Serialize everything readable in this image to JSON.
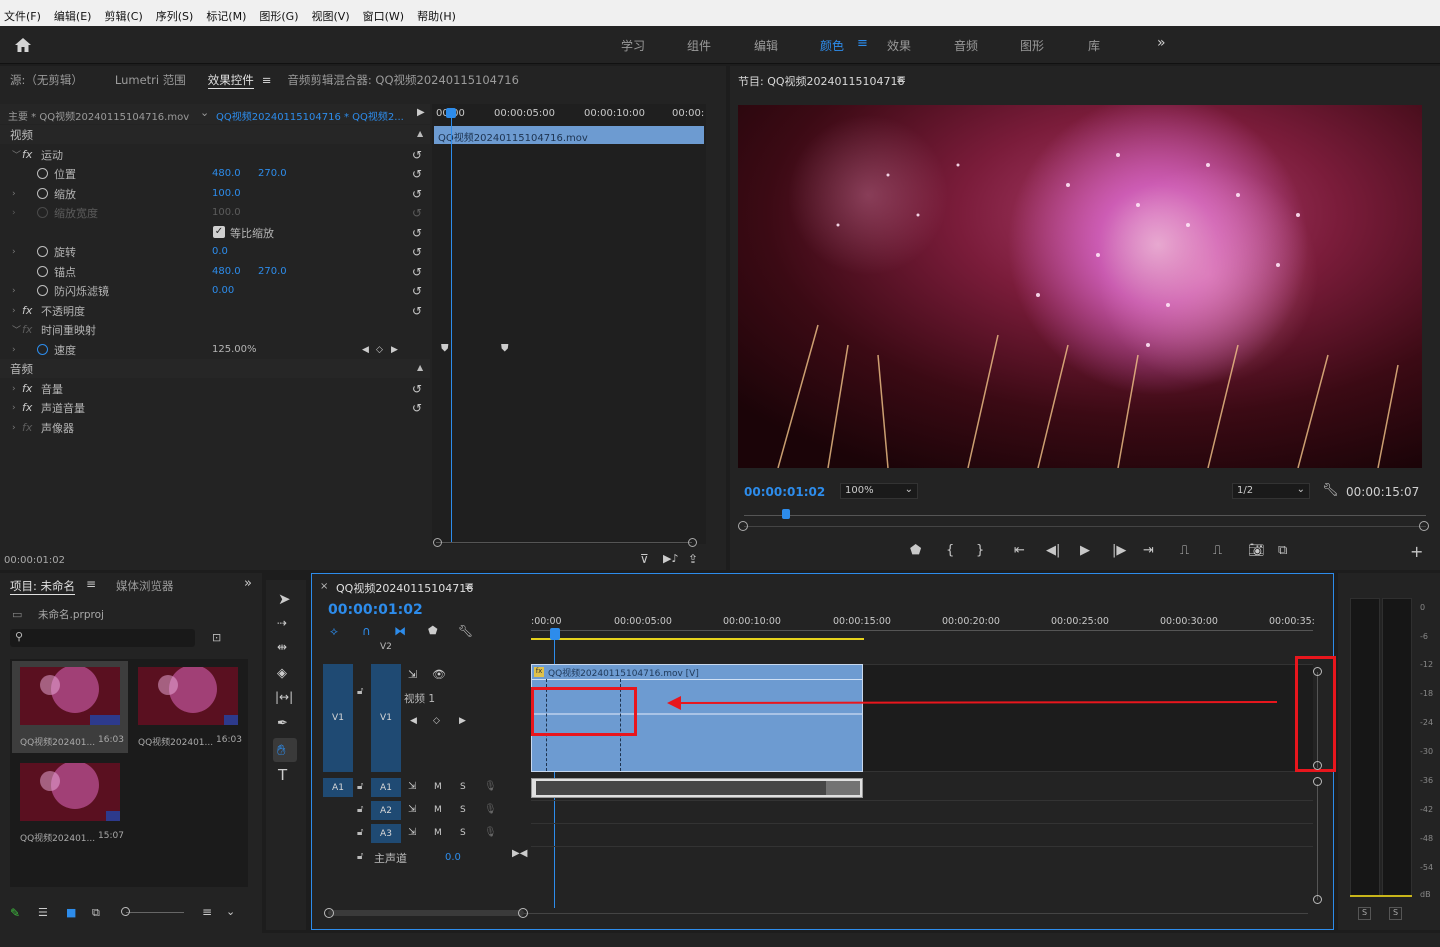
{
  "menu": [
    "文件(F)",
    "编辑(E)",
    "剪辑(C)",
    "序列(S)",
    "标记(M)",
    "图形(G)",
    "视图(V)",
    "窗口(W)",
    "帮助(H)"
  ],
  "workspaces": [
    "学习",
    "组件",
    "编辑",
    "颜色",
    "效果",
    "音频",
    "图形",
    "库"
  ],
  "active_workspace": "颜色",
  "source_tabs": {
    "source": "源:（无剪辑）",
    "lumetri": "Lumetri 范围",
    "effect_controls": "效果控件",
    "audio_mixer": "音频剪辑混合器: QQ视频20240115104716"
  },
  "ec": {
    "master": "主要 * QQ视频20240115104716.mov",
    "clip": "QQ视频20240115104716 * QQ视频2...",
    "ruler": [
      "00:00",
      "00:00:05:00",
      "00:00:10:00",
      "00:00:"
    ],
    "clipbar": "QQ视频20240115104716.mov",
    "video": "视频",
    "motion": "运动",
    "position": "位置",
    "pos_x": "480.0",
    "pos_y": "270.0",
    "scale": "缩放",
    "scale_v": "100.0",
    "scale_w": "缩放宽度",
    "scale_w_v": "100.0",
    "uniform": "等比缩放",
    "rotation": "旋转",
    "rot_v": "0.0",
    "anchor": "锚点",
    "anc_x": "480.0",
    "anc_y": "270.0",
    "flicker": "防闪烁滤镜",
    "flicker_v": "0.00",
    "opacity": "不透明度",
    "remap": "时间重映射",
    "speed": "速度",
    "speed_v": "125.00%",
    "audio": "音频",
    "volume": "音量",
    "channel": "声道音量",
    "panner": "声像器",
    "timecode": "00:00:01:02"
  },
  "program": {
    "title": "节目: QQ视频20240115104716",
    "timecode": "00:00:01:02",
    "zoom": "100%",
    "quality": "1/2",
    "duration": "00:00:15:07"
  },
  "project": {
    "tab": "项目: 未命名",
    "media": "媒体浏览器",
    "file": "未命名.prproj",
    "items": [
      {
        "name": "QQ视频202401...",
        "dur": "16:03"
      },
      {
        "name": "QQ视频202401...",
        "dur": "16:03"
      },
      {
        "name": "QQ视频202401...",
        "dur": "15:07"
      }
    ]
  },
  "timeline": {
    "title": "QQ视频20240115104716",
    "timecode": "00:00:01:02",
    "ruler": [
      ":00:00",
      "00:00:05:00",
      "00:00:10:00",
      "00:00:15:00",
      "00:00:20:00",
      "00:00:25:00",
      "00:00:30:00",
      "00:00:35:"
    ],
    "v2": "V2",
    "v1": "V1",
    "video1": "视频 1",
    "a1": "A1",
    "a2": "A2",
    "a3": "A3",
    "master": "主声道",
    "master_v": "0.0",
    "clip": "QQ视频20240115104716.mov [V]"
  },
  "meter": {
    "labels": [
      "0",
      "-6",
      "-12",
      "-18",
      "-24",
      "-30",
      "-36",
      "-42",
      "-48",
      "-54",
      "dB"
    ],
    "solo": "S"
  },
  "colors": {
    "accent": "#2d8ceb",
    "annotation": "#e8161d",
    "clip": "#6d9bd1"
  }
}
